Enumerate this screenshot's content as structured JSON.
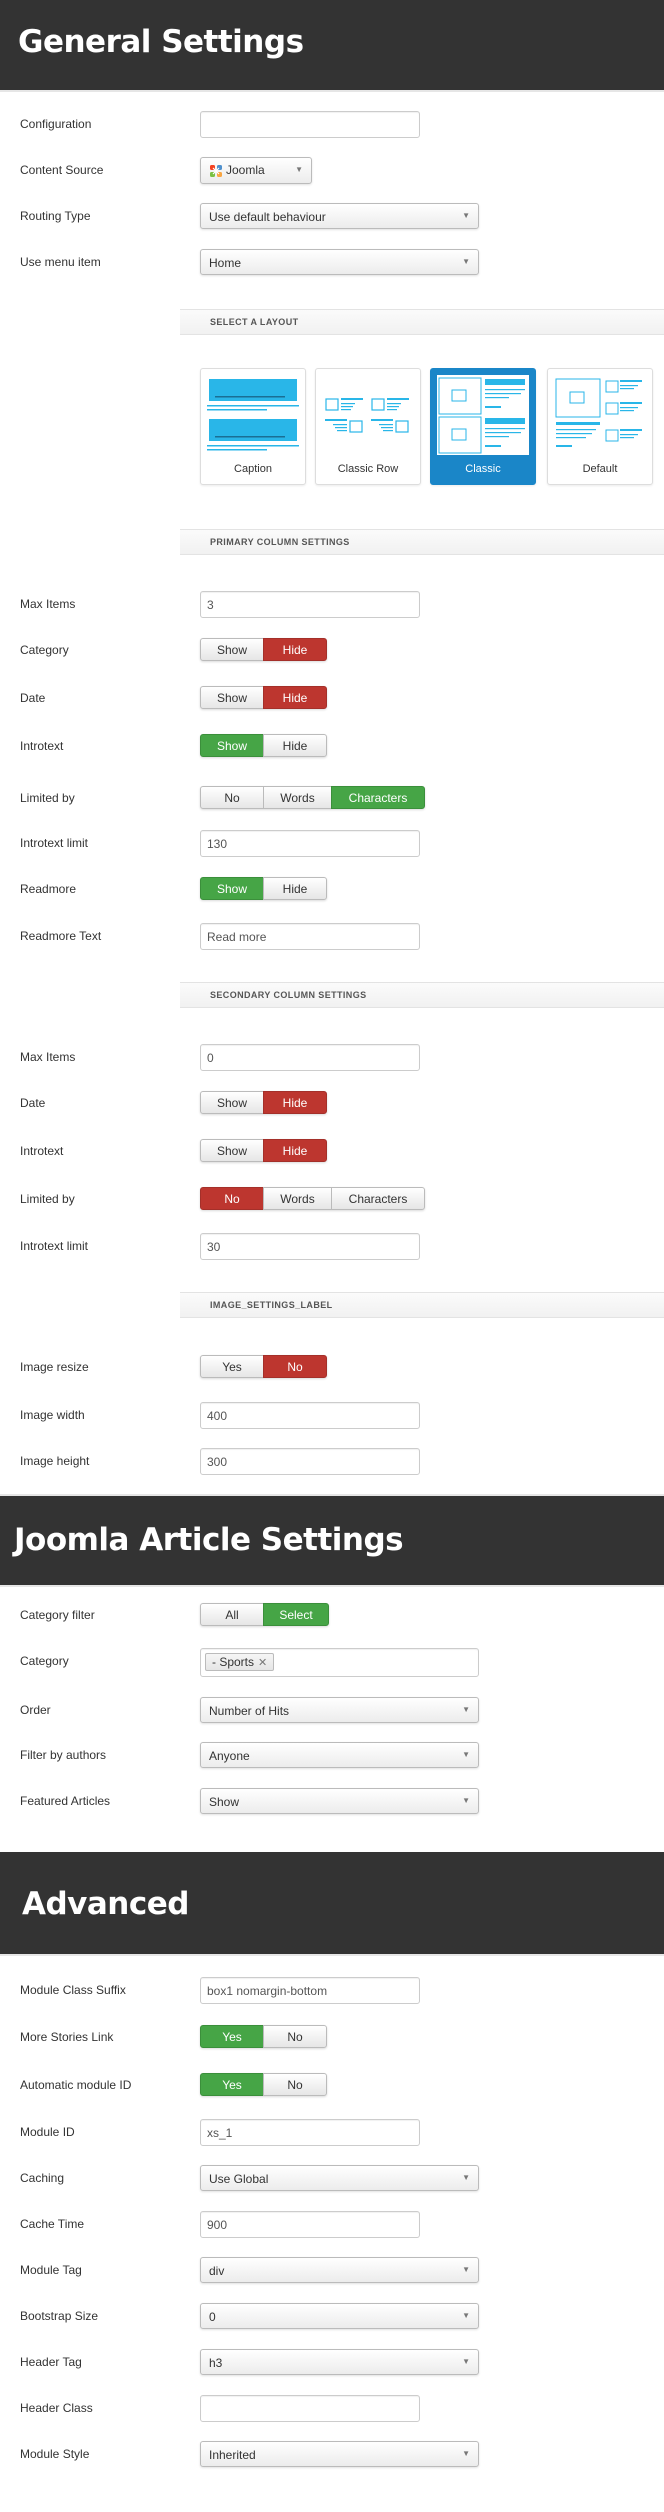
{
  "general": {
    "title": "General Settings",
    "configuration": {
      "label": "Configuration",
      "value": ""
    },
    "content_source": {
      "label": "Content Source",
      "value": "Joomla",
      "icon": "joomla-logo-icon"
    },
    "routing_type": {
      "label": "Routing Type",
      "value": "Use default behaviour"
    },
    "use_menu_item": {
      "label": "Use menu item",
      "value": "Home"
    },
    "layout_section": "SELECT A LAYOUT",
    "layouts": [
      {
        "name": "Caption",
        "selected": false
      },
      {
        "name": "Classic Row",
        "selected": false
      },
      {
        "name": "Classic",
        "selected": true
      },
      {
        "name": "Default",
        "selected": false
      }
    ],
    "primary_section": "PRIMARY COLUMN SETTINGS",
    "primary": {
      "max_items": {
        "label": "Max Items",
        "value": "3"
      },
      "category": {
        "label": "Category",
        "options": [
          "Show",
          "Hide"
        ],
        "selected": "Hide"
      },
      "date": {
        "label": "Date",
        "options": [
          "Show",
          "Hide"
        ],
        "selected": "Hide"
      },
      "introtext": {
        "label": "Introtext",
        "options": [
          "Show",
          "Hide"
        ],
        "selected": "Show"
      },
      "limited_by": {
        "label": "Limited by",
        "options": [
          "No",
          "Words",
          "Characters"
        ],
        "selected": "Characters"
      },
      "introtext_limit": {
        "label": "Introtext limit",
        "value": "130"
      },
      "readmore": {
        "label": "Readmore",
        "options": [
          "Show",
          "Hide"
        ],
        "selected": "Show"
      },
      "readmore_text": {
        "label": "Readmore Text",
        "value": "Read more"
      }
    },
    "secondary_section": "SECONDARY COLUMN SETTINGS",
    "secondary": {
      "max_items": {
        "label": "Max Items",
        "value": "0"
      },
      "date": {
        "label": "Date",
        "options": [
          "Show",
          "Hide"
        ],
        "selected": "Hide"
      },
      "introtext": {
        "label": "Introtext",
        "options": [
          "Show",
          "Hide"
        ],
        "selected": "Hide"
      },
      "limited_by": {
        "label": "Limited by",
        "options": [
          "No",
          "Words",
          "Characters"
        ],
        "selected": "No"
      },
      "introtext_limit": {
        "label": "Introtext limit",
        "value": "30"
      }
    },
    "image_section": "IMAGE_SETTINGS_LABEL",
    "image": {
      "resize": {
        "label": "Image resize",
        "options": [
          "Yes",
          "No"
        ],
        "selected": "No"
      },
      "width": {
        "label": "Image width",
        "value": "400"
      },
      "height": {
        "label": "Image height",
        "value": "300"
      }
    }
  },
  "article": {
    "title": "Joomla Article Settings",
    "category_filter": {
      "label": "Category filter",
      "options": [
        "All",
        "Select"
      ],
      "selected": "Select"
    },
    "category": {
      "label": "Category",
      "tags": [
        "- Sports"
      ]
    },
    "order": {
      "label": "Order",
      "value": "Number of Hits"
    },
    "filter_by_authors": {
      "label": "Filter by authors",
      "value": "Anyone"
    },
    "featured_articles": {
      "label": "Featured Articles",
      "value": "Show"
    }
  },
  "advanced": {
    "title": "Advanced",
    "module_class_suffix": {
      "label": "Module Class Suffix",
      "value": "box1 nomargin-bottom"
    },
    "more_stories_link": {
      "label": "More Stories Link",
      "options": [
        "Yes",
        "No"
      ],
      "selected": "Yes"
    },
    "automatic_module_id": {
      "label": "Automatic module ID",
      "options": [
        "Yes",
        "No"
      ],
      "selected": "Yes"
    },
    "module_id": {
      "label": "Module ID",
      "value": "xs_1"
    },
    "caching": {
      "label": "Caching",
      "value": "Use Global"
    },
    "cache_time": {
      "label": "Cache Time",
      "value": "900"
    },
    "module_tag": {
      "label": "Module Tag",
      "value": "div"
    },
    "bootstrap_size": {
      "label": "Bootstrap Size",
      "value": "0"
    },
    "header_tag": {
      "label": "Header Tag",
      "value": "h3"
    },
    "header_class": {
      "label": "Header Class",
      "value": ""
    },
    "module_style": {
      "label": "Module Style",
      "value": "Inherited"
    }
  },
  "colors": {
    "header_bg": "#333333",
    "toggle_red": "#bd362f",
    "toggle_green": "#46a546",
    "layout_selected": "#1a86c8",
    "layout_accent": "#29b6e8"
  }
}
